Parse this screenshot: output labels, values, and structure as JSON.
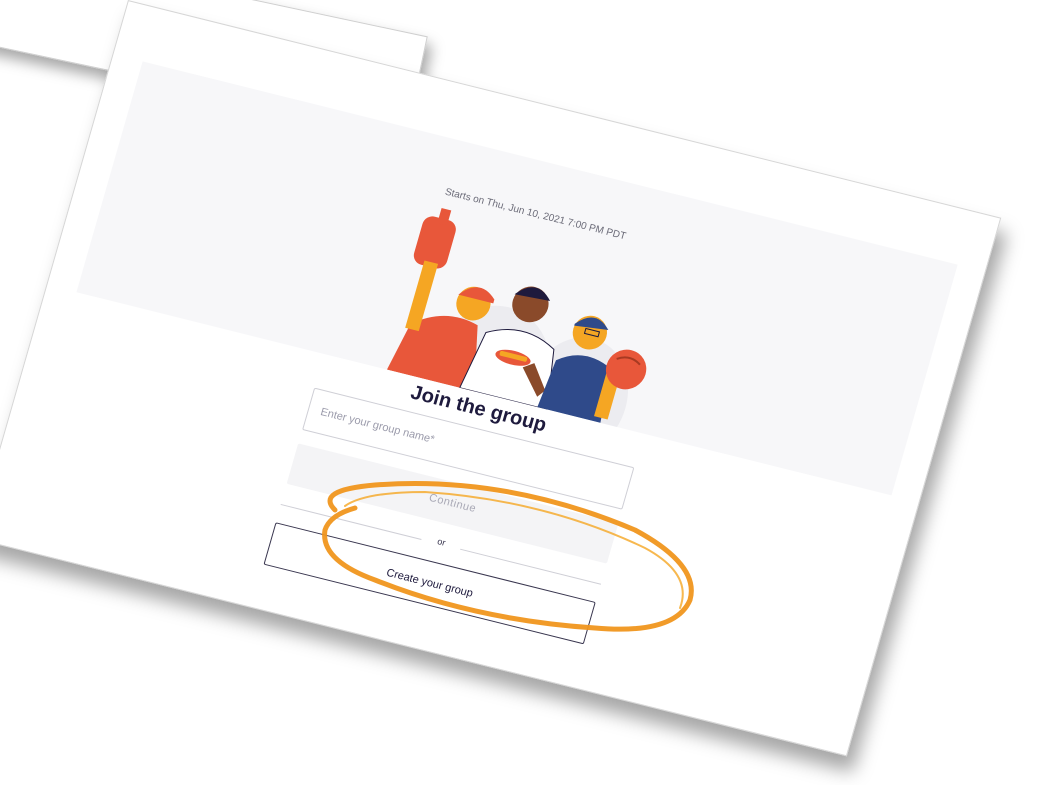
{
  "event": {
    "start_text": "Starts on Thu, Jun 10, 2021 7:00 PM PDT"
  },
  "form": {
    "title": "Join the group",
    "group_name_placeholder": "Enter your group name*",
    "group_name_value": "",
    "continue_label": "Continue",
    "divider_label": "or",
    "create_label": "Create your group"
  },
  "colors": {
    "accent_orange": "#f0781e",
    "title_text": "#1e1a3d",
    "hero_bg": "#f7f7f9",
    "disabled_button_bg": "#f4f4f6"
  },
  "icons": {
    "illustration": "baseball-fans-illustration",
    "highlight": "orange-hand-drawn-circle"
  }
}
